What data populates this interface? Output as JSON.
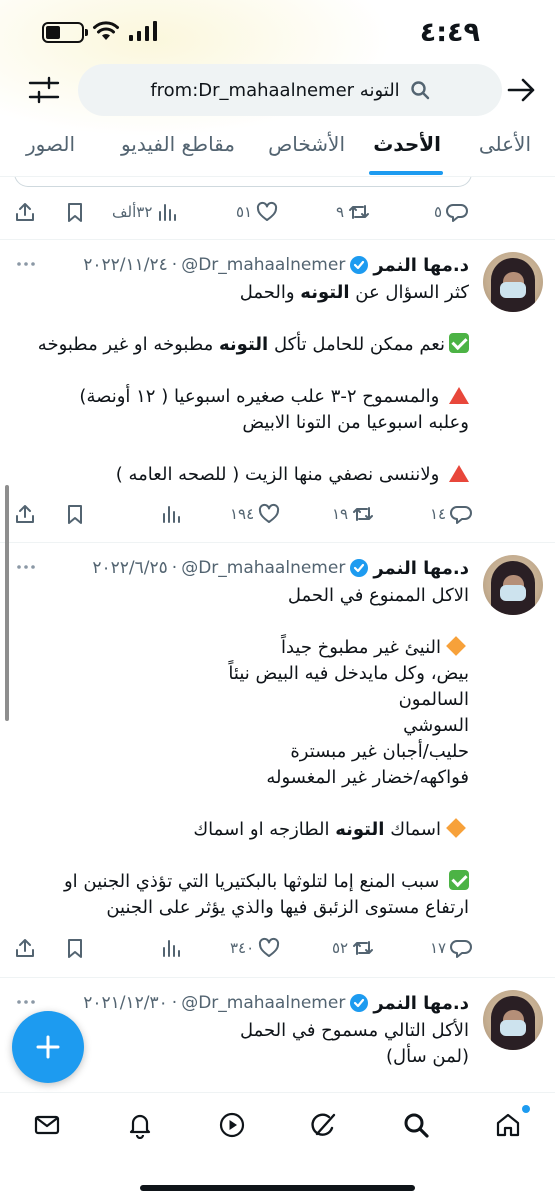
{
  "status_bar": {
    "time": "٤:٤٩"
  },
  "search": {
    "query": "from:Dr_mahaalnemer التونه"
  },
  "tabs": [
    {
      "label": "الأعلى",
      "active": false
    },
    {
      "label": "الأحدث",
      "active": true
    },
    {
      "label": "الأشخاص",
      "active": false
    },
    {
      "label": "مقاطع الفيديو",
      "active": false
    },
    {
      "label": "الصور",
      "active": false
    }
  ],
  "prev_tweet_actions": {
    "replies": "٥",
    "retweets": "٩",
    "likes": "٥١",
    "views": "٣٢ألف"
  },
  "tweets": [
    {
      "display_name": "د.مها النمر",
      "handle": "@Dr_mahaalnemer",
      "separator": "·",
      "date": "٢٠٢٢/١١/٢٤",
      "lines": [
        {
          "parts": [
            {
              "t": "كثر السؤال عن "
            },
            {
              "t": "التونه",
              "b": true
            },
            {
              "t": " والحمل"
            }
          ]
        },
        {
          "blank": true
        },
        {
          "emoji": "check",
          "parts": [
            {
              "t": "نعم ممكن للحامل تأكل "
            },
            {
              "t": "التونه",
              "b": true
            },
            {
              "t": " مطبوخه او غير مطبوخه"
            }
          ]
        },
        {
          "blank": true
        },
        {
          "emoji": "triangle",
          "parts": [
            {
              "t": " والمسموح  ٢-٣ علب صغيره اسبوعيا ( ١٢ أونصة)"
            }
          ]
        },
        {
          "parts": [
            {
              "t": "وعلبه اسبوعيا من التونا الابيض"
            }
          ]
        },
        {
          "blank": true
        },
        {
          "emoji": "triangle",
          "parts": [
            {
              "t": " ولاننسى نصفي منها الزيت ( للصحه العامه )"
            }
          ]
        }
      ],
      "actions": {
        "replies": "١٤",
        "retweets": "١٩",
        "likes": "١٩٤",
        "views": ""
      }
    },
    {
      "display_name": "د.مها النمر",
      "handle": "@Dr_mahaalnemer",
      "separator": "·",
      "date": "٢٠٢٢/٦/٢٥",
      "lines": [
        {
          "parts": [
            {
              "t": "الاكل الممنوع في الحمل"
            }
          ]
        },
        {
          "blank": true
        },
        {
          "emoji": "diamond",
          "parts": [
            {
              "t": "النيئ غير مطبوخ جيداً"
            }
          ]
        },
        {
          "parts": [
            {
              "t": "بيض، وكل مايدخل فيه البيض نيئاً"
            }
          ]
        },
        {
          "parts": [
            {
              "t": "السالمون"
            }
          ]
        },
        {
          "parts": [
            {
              "t": "السوشي"
            }
          ]
        },
        {
          "parts": [
            {
              "t": "حليب/أجبان غير مبسترة"
            }
          ]
        },
        {
          "parts": [
            {
              "t": "فواكهه/خضار غير المغسوله"
            }
          ]
        },
        {
          "blank": true
        },
        {
          "emoji": "diamond",
          "parts": [
            {
              "t": "اسماك "
            },
            {
              "t": "التونه",
              "b": true
            },
            {
              "t": " الطازجه او اسماك"
            }
          ]
        },
        {
          "blank": true
        },
        {
          "emoji": "check",
          "parts": [
            {
              "t": " سبب المنع إما لتلوثها بالبكتيريا التي تؤذي الجنين او"
            }
          ]
        },
        {
          "parts": [
            {
              "t": "ارتفاع مستوى الزئبق فيها والذي يؤثر على الجنين"
            }
          ]
        }
      ],
      "actions": {
        "replies": "١٧",
        "retweets": "٥٢",
        "likes": "٣٤٠",
        "views": ""
      }
    },
    {
      "display_name": "د.مها النمر",
      "handle": "@Dr_mahaalnemer",
      "separator": "·",
      "date": "٢٠٢١/١٢/٣٠",
      "lines": [
        {
          "parts": [
            {
              "t": "الأكل التالي مسموح في الحمل"
            }
          ]
        },
        {
          "parts": [
            {
              "t": "(لمن سأل)"
            }
          ]
        }
      ]
    }
  ],
  "colors": {
    "accent": "#1d9bf0",
    "text": "#0f1419",
    "muted": "#536471",
    "verified": "#1d9bf0"
  },
  "icons": {
    "nav": [
      "home-icon",
      "search-icon",
      "grok-icon",
      "video-icon",
      "notifications-icon",
      "messages-icon"
    ]
  }
}
